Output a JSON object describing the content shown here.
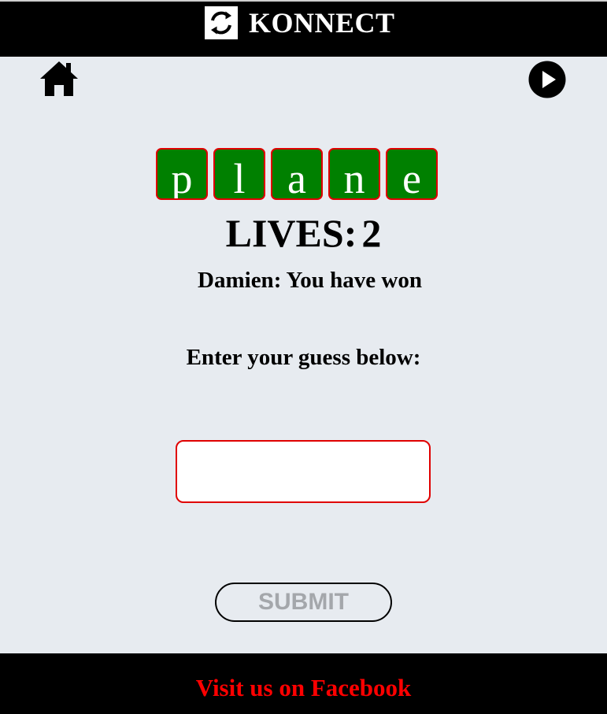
{
  "header": {
    "title": "KONNECT",
    "logo_icon": "refresh-arrows-icon"
  },
  "nav": {
    "home_icon": "home-icon",
    "play_icon": "play-icon"
  },
  "word": {
    "letters": [
      "p",
      "l",
      "a",
      "n",
      "e"
    ],
    "tile_color": "#008000",
    "tile_border_color": "#e00000"
  },
  "lives": {
    "label": "LIVES:",
    "value": "2"
  },
  "status": {
    "message": "Damien: You have won"
  },
  "guess": {
    "prompt": "Enter your guess below:",
    "value": "",
    "placeholder": ""
  },
  "submit": {
    "label": "SUBMIT"
  },
  "footer": {
    "link_label": "Visit us on Facebook",
    "link_color": "#ff0000"
  },
  "colors": {
    "background": "#e7ebf0",
    "bar": "#000000",
    "accent": "#e00000"
  }
}
